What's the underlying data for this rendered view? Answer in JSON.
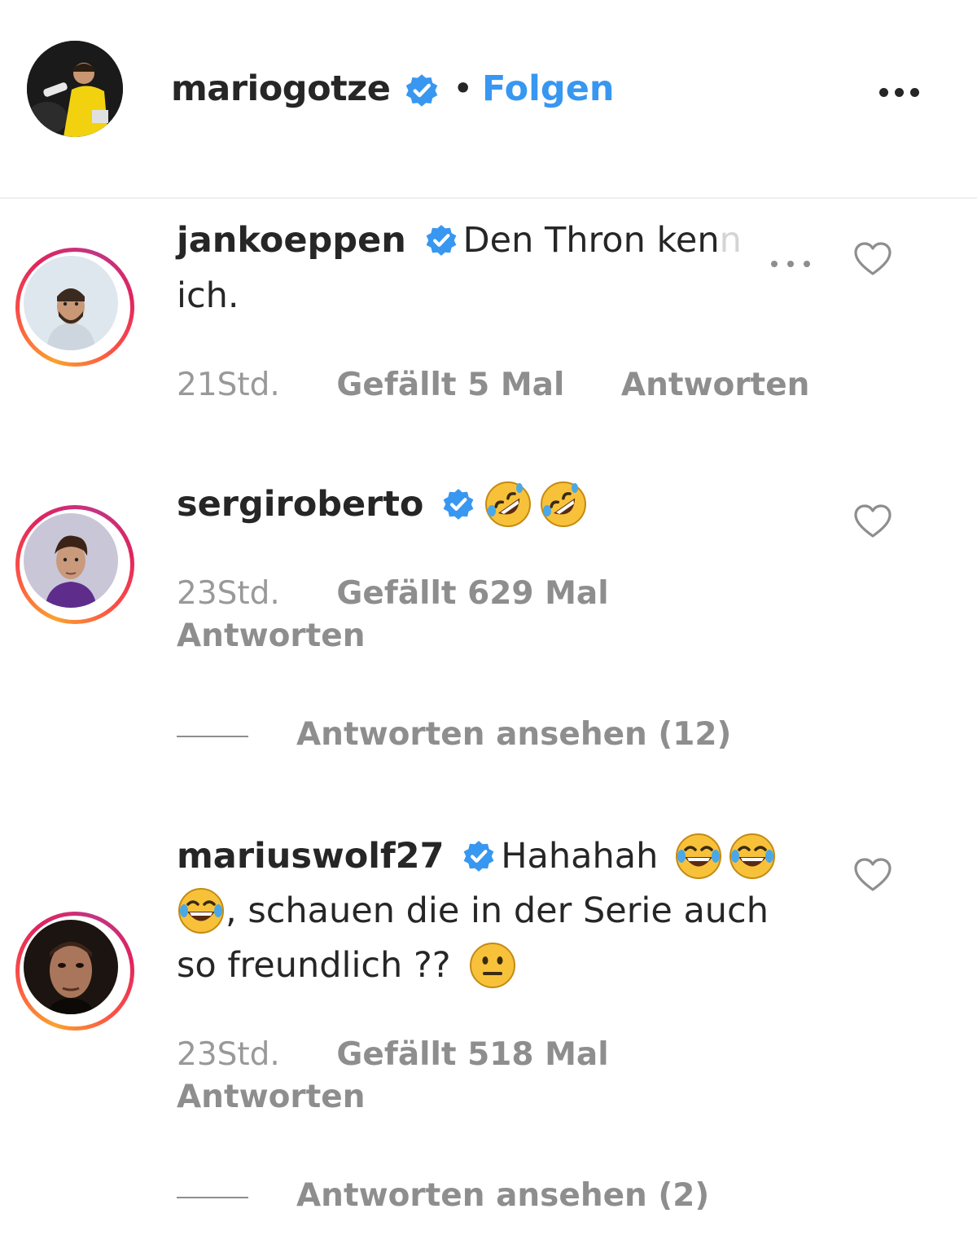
{
  "header": {
    "username": "mariogotze",
    "separator": "•",
    "follow_label": "Folgen"
  },
  "comments": [
    {
      "username": "jankoeppen",
      "text_line1": "Den Thron ken",
      "text_fade": "n",
      "text_line2": "ich.",
      "time": "21Std.",
      "likes": "Gefällt 5 Mal",
      "reply_label": "Antworten"
    },
    {
      "username": "sergiroberto",
      "time": "23Std.",
      "likes": "Gefällt 629 Mal",
      "reply_label": "Antworten",
      "view_replies": "Antworten ansehen (12)"
    },
    {
      "username": "mariuswolf27",
      "text_line1": "Hahahah",
      "text_line2": ", schauen die in der Serie auch",
      "text_line3": "so freundlich ??",
      "time": "23Std.",
      "likes": "Gefällt 518 Mal",
      "reply_label": "Antworten",
      "view_replies": "Antworten ansehen (2)"
    }
  ],
  "colors": {
    "link_blue": "#3897f0",
    "verified_blue": "#3897f0",
    "text": "#262626",
    "secondary": "#8e8e8e",
    "emoji_yellow": "#f7c23a"
  },
  "icons": [
    "verified-badge-icon",
    "more-options-icon",
    "heart-icon",
    "rofl-emoji",
    "joy-emoji",
    "neutral-face-emoji"
  ]
}
